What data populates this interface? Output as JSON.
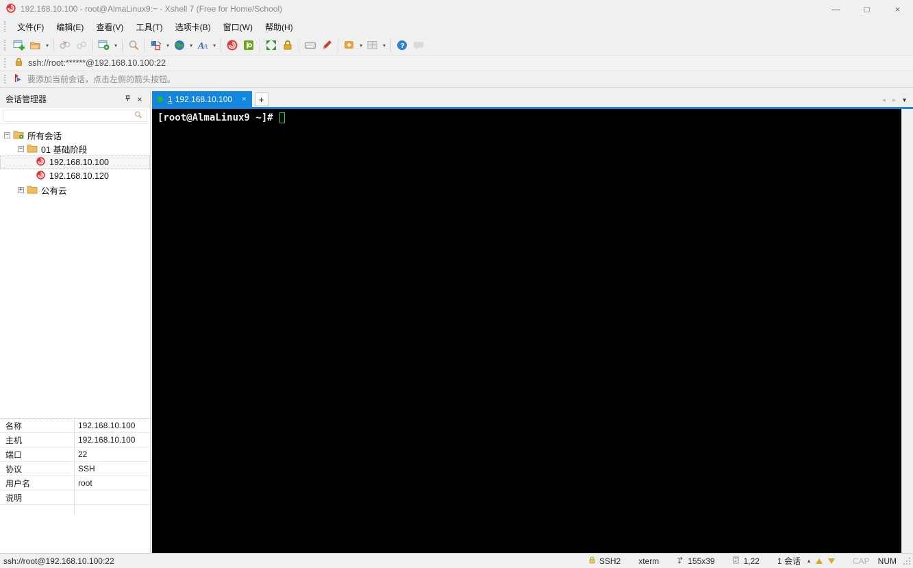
{
  "window": {
    "title": "192.168.10.100 - root@AlmaLinux9:~ - Xshell 7 (Free for Home/School)"
  },
  "glyphs": {
    "minimize": "—",
    "maximize": "□",
    "close": "×",
    "dropdown": "▾",
    "panel_close": "×",
    "tab_close": "×",
    "new_tab": "+",
    "tab_left": "◂",
    "tab_right": "▸",
    "session_tri": "▴",
    "expanded": "−",
    "collapsed": "+"
  },
  "menu": {
    "items": [
      "文件(F)",
      "编辑(E)",
      "查看(V)",
      "工具(T)",
      "选项卡(B)",
      "窗口(W)",
      "帮助(H)"
    ]
  },
  "toolbar": {
    "icons": [
      "new-session",
      "open-folder",
      "disconnect",
      "reconnect",
      "session-properties",
      "find",
      "compose-pane",
      "encoding-globe",
      "font",
      "new-xshell-session",
      "xftp-transfer",
      "fullscreen",
      "lock-screen",
      "virtual-keyboard",
      "highlight",
      "new-layout",
      "layout-grid",
      "help",
      "feedback"
    ]
  },
  "address_bar": {
    "url": "ssh://root:******@192.168.10.100:22"
  },
  "info_bar": {
    "message": "要添加当前会话，点击左侧的箭头按钮。"
  },
  "session_manager": {
    "title": "会话管理器",
    "search_value": "",
    "tree": {
      "root": "所有会话",
      "folder1": "01 基础阶段",
      "session1": "192.168.10.100",
      "session2": "192.168.10.120",
      "folder2": "公有云"
    }
  },
  "properties": {
    "rows": [
      {
        "label": "名称",
        "value": "192.168.10.100"
      },
      {
        "label": "主机",
        "value": "192.168.10.100"
      },
      {
        "label": "端口",
        "value": "22"
      },
      {
        "label": "协议",
        "value": "SSH"
      },
      {
        "label": "用户名",
        "value": "root"
      },
      {
        "label": "说明",
        "value": ""
      }
    ]
  },
  "tabbar": {
    "active_tab": {
      "number": "1",
      "label": "192.168.10.100"
    }
  },
  "terminal": {
    "prompt": "[root@AlmaLinux9 ~]#"
  },
  "status_bar": {
    "connection": "ssh://root@192.168.10.100:22",
    "protocol": "SSH2",
    "terminal_type": "xterm",
    "size": "155x39",
    "cursor_position": "1,22",
    "session_count": "1 会话",
    "caps": "CAP",
    "num": "NUM"
  }
}
